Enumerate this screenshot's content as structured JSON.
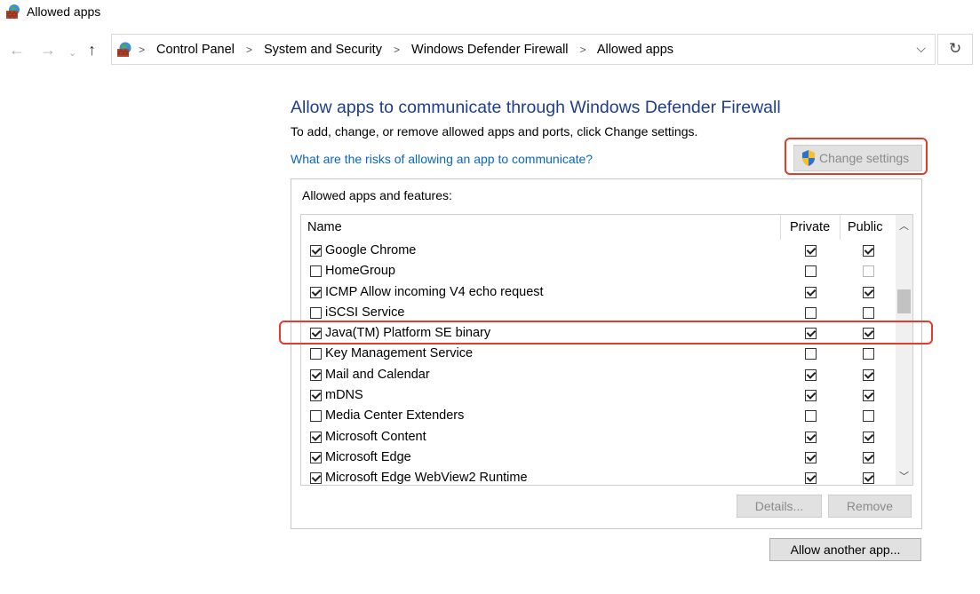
{
  "window": {
    "title": "Allowed apps",
    "icon": "firewall-icon"
  },
  "nav": {
    "back_icon": "back-arrow-icon",
    "forward_icon": "forward-arrow-icon",
    "recent_icon": "chevron-down-icon",
    "up_icon": "up-arrow-icon",
    "breadcrumbs": [
      "Control Panel",
      "System and Security",
      "Windows Defender Firewall",
      "Allowed apps"
    ],
    "separator": ">",
    "refresh_icon": "refresh-icon"
  },
  "main": {
    "heading": "Allow apps to communicate through Windows Defender Firewall",
    "subtext": "To add, change, or remove allowed apps and ports, click Change settings.",
    "risk_link": "What are the risks of allowing an app to communicate?",
    "change_settings_label": "Change settings",
    "group_label": "Allowed apps and features:"
  },
  "table": {
    "columns": {
      "name": "Name",
      "private": "Private",
      "public": "Public"
    },
    "rows": [
      {
        "name": "Google Chrome",
        "enabled": true,
        "private": true,
        "public": true
      },
      {
        "name": "HomeGroup",
        "enabled": false,
        "private": false,
        "public": false
      },
      {
        "name": "ICMP Allow incoming V4 echo request",
        "enabled": true,
        "private": true,
        "public": true
      },
      {
        "name": "iSCSI Service",
        "enabled": false,
        "private": false,
        "public": false
      },
      {
        "name": "Java(TM) Platform SE binary",
        "enabled": true,
        "private": true,
        "public": true
      },
      {
        "name": "Key Management Service",
        "enabled": false,
        "private": false,
        "public": false
      },
      {
        "name": "Mail and Calendar",
        "enabled": true,
        "private": true,
        "public": true
      },
      {
        "name": "mDNS",
        "enabled": true,
        "private": true,
        "public": true
      },
      {
        "name": "Media Center Extenders",
        "enabled": false,
        "private": false,
        "public": false
      },
      {
        "name": "Microsoft Content",
        "enabled": true,
        "private": true,
        "public": true
      },
      {
        "name": "Microsoft Edge",
        "enabled": true,
        "private": true,
        "public": true
      },
      {
        "name": "Microsoft Edge WebView2 Runtime",
        "enabled": true,
        "private": true,
        "public": true
      }
    ]
  },
  "buttons": {
    "details": "Details...",
    "remove": "Remove",
    "allow_another": "Allow another app..."
  },
  "colors": {
    "heading": "#1e3d8f",
    "link": "#0a66c2",
    "highlight": "#e53a2f"
  }
}
